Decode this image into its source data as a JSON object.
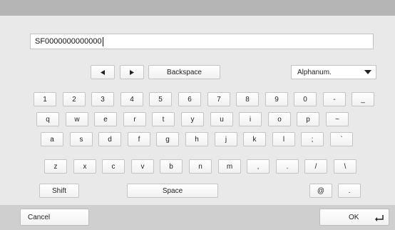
{
  "input": {
    "value": "SF0000000000000"
  },
  "controls": {
    "backspace_label": "Backspace",
    "mode_selected": "Alphanum."
  },
  "icons": {
    "left": "arrow-left-icon",
    "right": "arrow-right-icon",
    "select": "chevron-down-icon",
    "enter": "enter-icon"
  },
  "rows": [
    [
      "1",
      "2",
      "3",
      "4",
      "5",
      "6",
      "7",
      "8",
      "9",
      "0",
      "-",
      "_"
    ],
    [
      "q",
      "w",
      "e",
      "r",
      "t",
      "y",
      "u",
      "i",
      "o",
      "p",
      "~"
    ],
    [
      "a",
      "s",
      "d",
      "f",
      "g",
      "h",
      "j",
      "k",
      "l",
      ";",
      "`"
    ],
    [
      "z",
      "x",
      "c",
      "v",
      "b",
      "n",
      "m",
      ",",
      ".",
      "/",
      "\\"
    ]
  ],
  "bottom": {
    "shift_label": "Shift",
    "space_label": "Space",
    "at_label": "@",
    "dot_label": "."
  },
  "footer": {
    "cancel_label": "Cancel",
    "ok_label": "OK"
  }
}
